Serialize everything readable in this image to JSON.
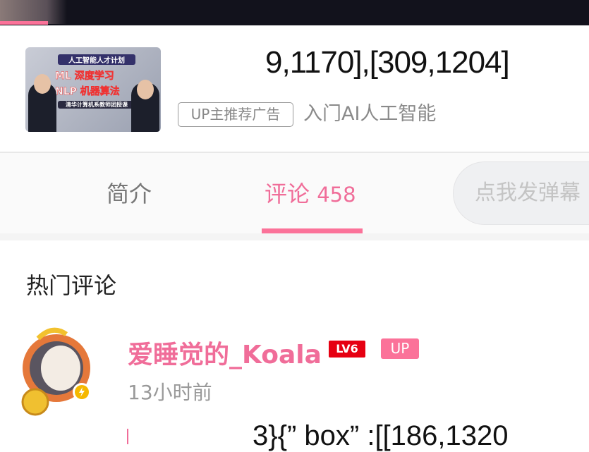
{
  "player": {
    "progress_percent": 8
  },
  "ad": {
    "thumbnail": {
      "tag": "人工智能人才计划",
      "line1": "ML  深度学习",
      "line2": "NLP 机器算法",
      "line3": "清华计算机系教师团授课"
    },
    "title": "9,1170],[309,1204]",
    "badge": "UP主推荐广告",
    "advertiser": "入门AI人工智能"
  },
  "tabs": [
    {
      "label": "简介"
    },
    {
      "label": "评论",
      "count": "458",
      "active": true
    }
  ],
  "danmaku_input": {
    "placeholder": "点我发弹幕"
  },
  "comments": {
    "section_title": "热门评论",
    "items": [
      {
        "username": "爱睡觉的_Koala",
        "level": "LV6",
        "up_badge": "UP",
        "time": "13小时前",
        "text": "3}{” box” :[[186,1320"
      }
    ]
  },
  "colors": {
    "accent": "#fb7299",
    "username": "#f06d99",
    "level_badge": "#e60012"
  }
}
